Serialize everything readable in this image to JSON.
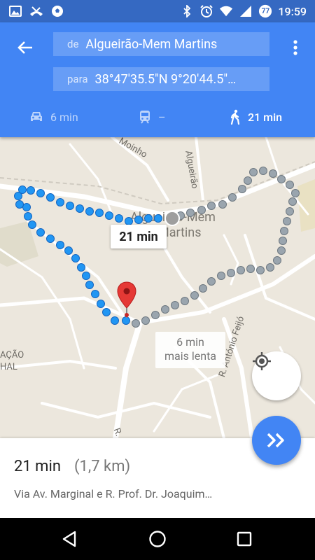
{
  "status_bar": {
    "time": "19:59",
    "battery_level": "77",
    "icons_left": [
      "image-icon",
      "missed-call-icon",
      "soccer-ball-icon"
    ],
    "icons_right": [
      "bluetooth-icon",
      "alarm-icon",
      "wifi-icon",
      "signal-icon",
      "battery-icon"
    ]
  },
  "directions": {
    "from_prefix": "de",
    "from_value": "Algueirão-Mem Martins",
    "to_prefix": "para",
    "to_value": "38°47'35.5\"N 9°20'44.5\"…"
  },
  "modes": {
    "drive": {
      "icon": "car-icon",
      "label": "6 min"
    },
    "transit": {
      "icon": "train-icon",
      "label": "–"
    },
    "walk": {
      "icon": "walk-icon",
      "label": "21 min"
    }
  },
  "map": {
    "place_name_line1": "Algueirão-Mem",
    "place_name_line2": "Martins",
    "route_time_tag": "21 min",
    "alt_route_line1": "6 min",
    "alt_route_line2": "mais lenta",
    "street_labels": {
      "moinho": "Moinho",
      "algueirao": "Algueirão",
      "feijo": "R. António Feijó",
      "acao": "AÇÃO",
      "hal": "HAL",
      "r": "R."
    },
    "colors": {
      "route": "#2196f3",
      "route_alt": "#9aa5ae",
      "marker": "#e53935",
      "map_bg": "#ece7dd"
    }
  },
  "summary": {
    "time": "21 min",
    "distance": "(1,7 km)",
    "via": "Via Av. Marginal e R. Prof. Dr. Joaquim…"
  }
}
